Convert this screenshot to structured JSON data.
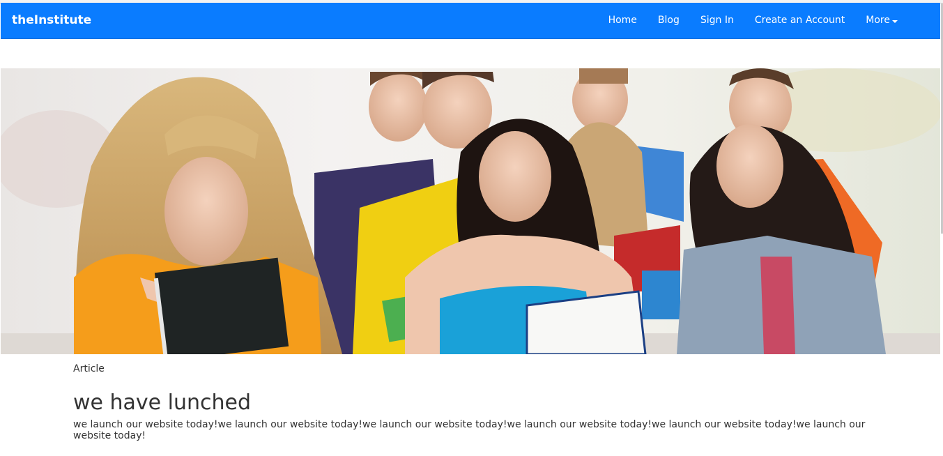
{
  "navbar": {
    "brand": "theInstitute",
    "links": [
      {
        "label": "Home"
      },
      {
        "label": "Blog"
      },
      {
        "label": "Sign In"
      },
      {
        "label": "Create an Account"
      },
      {
        "label": "More"
      }
    ],
    "background_color": "#0a7cff"
  },
  "hero": {
    "image": "group-of-smiling-students-holding-notebooks"
  },
  "article": {
    "kicker": "Article",
    "title": "we have lunched",
    "body": "we launch our website today!we launch our website today!we launch our website today!we launch our website today!we launch our website today!we launch our website today!"
  }
}
